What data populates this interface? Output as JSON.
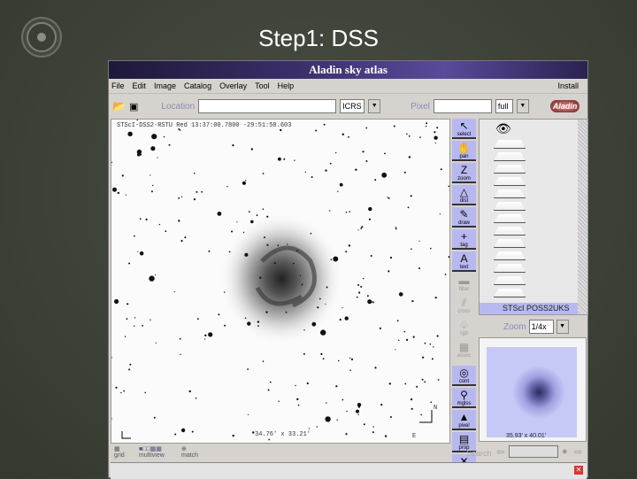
{
  "slide": {
    "title": "Step1: DSS"
  },
  "window": {
    "title": "Aladin sky atlas"
  },
  "menu": [
    "File",
    "Edit",
    "Image",
    "Catalog",
    "Overlay",
    "Tool",
    "Help"
  ],
  "menu_right": "Install",
  "toolbar": {
    "location_label": "Location",
    "location_value": "",
    "frame": "ICRS",
    "pixel_label": "Pixel",
    "pixel_value": "",
    "pixel_mode": "full",
    "logo": "Aladin"
  },
  "view": {
    "header": "STScI-DSS2-RSTU Red 13:37:00.7800 -29:51:58.603",
    "size": "34.76' x 33.21'",
    "north": "N",
    "east": "E"
  },
  "tools": [
    {
      "label": "select",
      "icon": "↖"
    },
    {
      "label": "pan",
      "icon": "✋"
    },
    {
      "label": "zoom",
      "icon": "Z"
    },
    {
      "label": "dist",
      "icon": "△"
    },
    {
      "label": "draw",
      "icon": "✎"
    },
    {
      "label": "tag",
      "icon": "+"
    },
    {
      "label": "text",
      "icon": "A"
    },
    {
      "label": "filter",
      "icon": "▬"
    },
    {
      "label": "cross",
      "icon": "⫽"
    },
    {
      "label": "rgb",
      "icon": "♧"
    },
    {
      "label": "assoc",
      "icon": "▦"
    }
  ],
  "tools2": [
    {
      "label": "cont",
      "icon": "◎"
    },
    {
      "label": "mglss",
      "icon": "⚲"
    },
    {
      "label": "pixel",
      "icon": "▲"
    },
    {
      "label": "prop",
      "icon": "▤"
    },
    {
      "label": "del",
      "icon": "✕"
    }
  ],
  "stack": {
    "selected_plane": "STScI POSS2UKS"
  },
  "zoom": {
    "label": "Zoom",
    "value": "1/4x"
  },
  "thumbnail": {
    "size": "35.93' x 40.01'"
  },
  "bottom": {
    "grid": "grid",
    "multiview": "multiview",
    "match": "match",
    "search": "Search"
  }
}
